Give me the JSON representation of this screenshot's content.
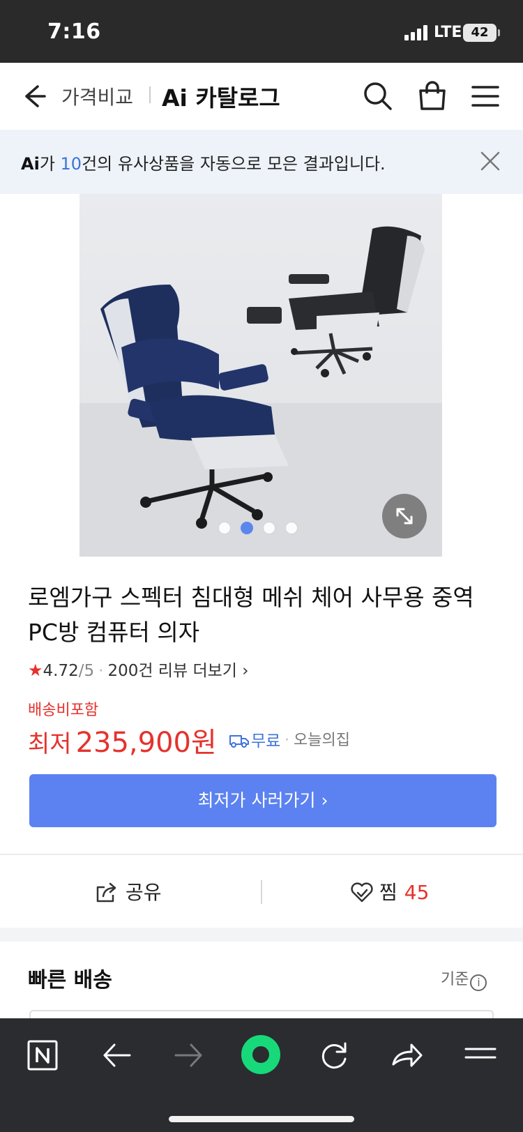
{
  "status": {
    "time": "7:16",
    "network": "LTE",
    "battery": "42"
  },
  "header": {
    "breadcrumb": "가격비교",
    "title": "Ai 카탈로그"
  },
  "banner": {
    "ai_label": "Ai",
    "prefix": "가 ",
    "count": "10",
    "suffix": "건의 유사상품을 자동으로 모은 결과입니다."
  },
  "gallery": {
    "image_count": 4,
    "active_index": 1
  },
  "product": {
    "title": "로엠가구 스펙터 침대형 메쉬 체어 사무용 중역 PC방 컴퓨터 의자",
    "rating": "4.72",
    "rating_max": "/5",
    "review_link": "200건 리뷰 더보기",
    "shipping_included": "배송비포함",
    "price_label": "최저",
    "price_value": "235,900원",
    "free_shipping": "무료",
    "seller": "오늘의집",
    "buy_button": "최저가 사러가기 ›"
  },
  "actions": {
    "share_label": "공유",
    "like_label": "찜",
    "like_count": "45"
  },
  "fast_shipping": {
    "title": "빠른 배송",
    "standard_label": "기준"
  },
  "colors": {
    "accent_blue": "#5b82f0",
    "price_red": "#e5322d",
    "link_blue": "#3d73d8"
  },
  "bottom_bar": {
    "icons": [
      "naver-n-icon",
      "back-arrow-icon",
      "forward-arrow-icon",
      "green-dot-icon",
      "refresh-icon",
      "share-icon",
      "menu-icon"
    ]
  }
}
